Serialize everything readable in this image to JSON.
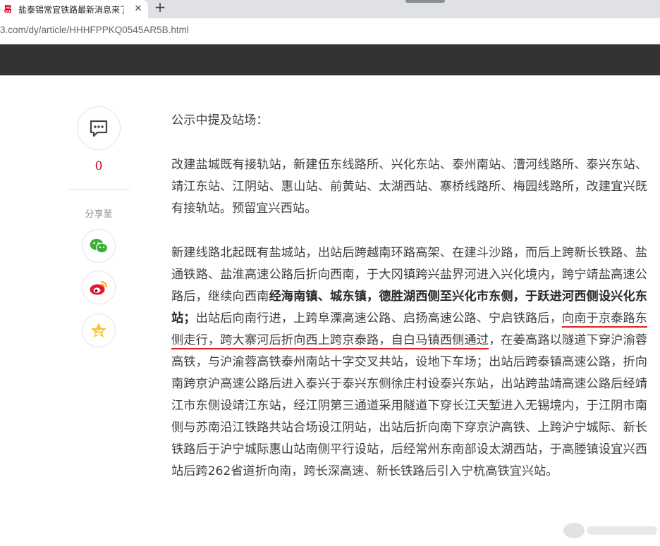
{
  "browser": {
    "tab_title": "盐泰锡常宜铁路最新消息来了",
    "favicon_glyph": "易",
    "close_glyph": "✕",
    "new_tab_glyph": "+",
    "url": "3.com/dy/article/HHHFPPKQ0545AR5B.html"
  },
  "share": {
    "comment_count": "0",
    "share_label": "分享至",
    "icons": [
      "comment-icon",
      "wechat-icon",
      "weibo-icon",
      "qzone-icon"
    ]
  },
  "article": {
    "p1": "公示中提及站场：",
    "p2": "改建盐城既有接轨站，新建伍东线路所、兴化东站、泰州南站、漕河线路所、泰兴东站、靖江东站、江阴站、惠山站、前黄站、太湖西站、寨桥线路所、梅园线路所，改建宜兴既有接轨站。预留宜兴西站。",
    "p3_a": "新建线路北起既有盐城站，出站后跨越南环路高架、在建斗沙路，而后上跨新长铁路、盐通铁路、盐淮高速公路后折向西南，于大冈镇跨兴盐界河进入兴化境内，跨宁靖盐高速公路后，继续向西南",
    "p3_bold": "经海南镇、城东镇，德胜湖西侧至兴化市东侧，于跃进河西侧设兴化东站；",
    "p3_b": "出站后向南行进，上跨阜溧高速公路、启扬高速公路、宁启铁路后，",
    "p3_underlined": "向南于京泰路东侧走行，跨大寨河后折向西上跨京泰路，自白马镇西侧通过",
    "p3_c": "，在姜高路以隧道下穿沪渝蓉高铁，与沪渝蓉高铁泰州南站十字交叉共站，设地下车场；出站后跨泰镇高速公路，折向南跨京沪高速公路后进入泰兴于泰兴东侧徐庄村设泰兴东站，出站跨盐靖高速公路后经靖江市东侧设靖江东站，经江阴第三通道采用隧道下穿长江天堑进入无锡境内，于江阴市南侧与苏南沿江铁路共站合场设江阴站，出站后折向南下穿京沪高铁、上跨沪宁城际、新长铁路后于沪宁城际惠山站南侧平行设站，后经常州东南部设太湖西站，于高塍镇设宜兴西站后跨262省道折向南，跨长深高速、新长铁路后引入宁杭高铁宜兴站。"
  },
  "colors": {
    "header_bg": "#333333",
    "accent_red": "#d0021b",
    "text": "#404040"
  }
}
